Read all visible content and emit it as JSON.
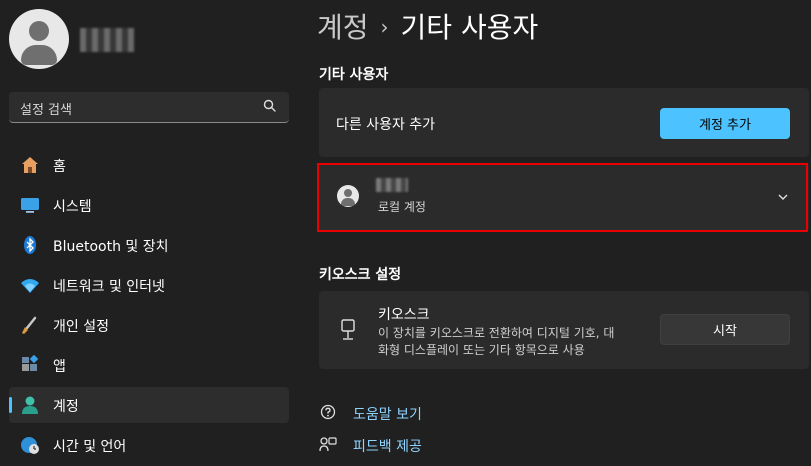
{
  "breadcrumb": {
    "parent": "계정",
    "separator": "›",
    "current": "기타 사용자"
  },
  "search": {
    "placeholder": "설정 검색"
  },
  "sidebar": {
    "items": [
      {
        "label": "홈",
        "icon": "home-icon"
      },
      {
        "label": "시스템",
        "icon": "system-icon"
      },
      {
        "label": "Bluetooth 및 장치",
        "icon": "bluetooth-icon"
      },
      {
        "label": "네트워크 및 인터넷",
        "icon": "wifi-icon"
      },
      {
        "label": "개인 설정",
        "icon": "brush-icon"
      },
      {
        "label": "앱",
        "icon": "apps-icon"
      },
      {
        "label": "계정",
        "icon": "account-icon",
        "active": true
      },
      {
        "label": "시간 및 언어",
        "icon": "globe-clock-icon"
      }
    ]
  },
  "other_users": {
    "heading": "기타 사용자",
    "add_user_label": "다른 사용자 추가",
    "add_account_button": "계정 추가",
    "account": {
      "type": "로컬 계정"
    }
  },
  "kiosk": {
    "heading": "키오스크 설정",
    "title": "키오스크",
    "description_line1": "이 장치를 키오스크로 전환하여 디지털 기호, 대",
    "description_line2": "화형 디스플레이 또는 기타 항목으로 사용",
    "start_button": "시작"
  },
  "links": [
    {
      "label": "도움말 보기",
      "icon": "help-icon"
    },
    {
      "label": "피드백 제공",
      "icon": "feedback-icon"
    }
  ],
  "colors": {
    "accent": "#4cc2ff",
    "highlight": "#ea0000",
    "background": "#202020",
    "card": "#2b2b2b"
  }
}
